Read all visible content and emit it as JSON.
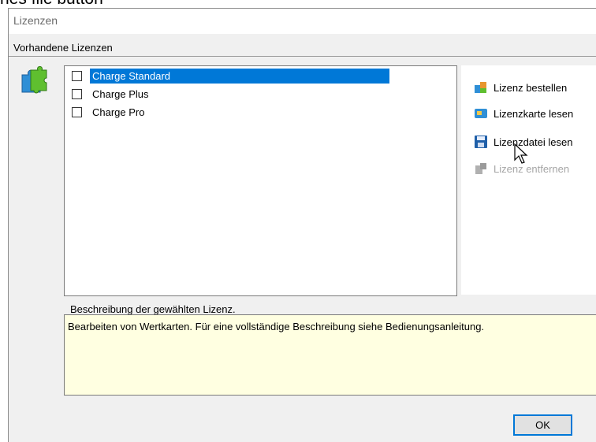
{
  "window": {
    "title": "Lizenzen"
  },
  "page_top": {
    "partial_text": "hes file  button"
  },
  "licenses": {
    "group_label": "Vorhandene Lizenzen",
    "items": [
      {
        "label": "Charge Standard",
        "checked": false,
        "selected": true
      },
      {
        "label": "Charge Plus",
        "checked": false,
        "selected": false
      },
      {
        "label": "Charge Pro",
        "checked": false,
        "selected": false
      }
    ]
  },
  "actions": [
    {
      "label": "Lizenz bestellen",
      "icon": "puzzle-order-icon",
      "enabled": true
    },
    {
      "label": "Lizenzkarte lesen",
      "icon": "card-reader-icon",
      "enabled": true
    },
    {
      "label": "Lizenzdatei lesen",
      "icon": "floppy-disk-icon",
      "enabled": true
    },
    {
      "label": "Lizenz entfernen",
      "icon": "puzzle-remove-icon",
      "enabled": false
    }
  ],
  "description": {
    "label": "Beschreibung der gewählten Lizenz.",
    "text": "Bearbeiten von Wertkarten. Für eine vollständige Beschreibung siehe Bedienungsanleitung."
  },
  "ok_button": {
    "label": "OK"
  },
  "colors": {
    "selection": "#0078d7",
    "description_background": "#ffffe1",
    "dialog_background": "#f0f0f0",
    "disabled_text": "#a6a6a6"
  }
}
